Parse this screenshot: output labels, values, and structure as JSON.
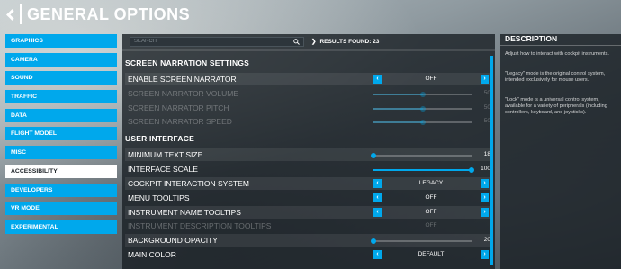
{
  "header": {
    "title": "GENERAL OPTIONS"
  },
  "sidebar": {
    "items": [
      {
        "label": "GRAPHICS",
        "active": false
      },
      {
        "label": "CAMERA",
        "active": false
      },
      {
        "label": "SOUND",
        "active": false
      },
      {
        "label": "TRAFFIC",
        "active": false
      },
      {
        "label": "DATA",
        "active": false
      },
      {
        "label": "FLIGHT MODEL",
        "active": false
      },
      {
        "label": "MISC",
        "active": false
      },
      {
        "label": "ACCESSIBILITY",
        "active": true
      },
      {
        "label": "DEVELOPERS",
        "active": false
      },
      {
        "label": "VR MODE",
        "active": false
      },
      {
        "label": "EXPERIMENTAL",
        "active": false
      }
    ]
  },
  "search": {
    "placeholder": "SEARCH",
    "value": ""
  },
  "results": {
    "label": "RESULTS FOUND: 23"
  },
  "sections": {
    "narration": {
      "title": "SCREEN NARRATION SETTINGS",
      "enable_narrator": {
        "label": "ENABLE SCREEN NARRATOR",
        "value": "OFF"
      },
      "volume": {
        "label": "SCREEN NARRATOR VOLUME",
        "value": "50",
        "fraction": 0.5
      },
      "pitch": {
        "label": "SCREEN NARRATOR PITCH",
        "value": "50",
        "fraction": 0.5
      },
      "speed": {
        "label": "SCREEN NARRATOR SPEED",
        "value": "50",
        "fraction": 0.5
      }
    },
    "ui": {
      "title": "USER INTERFACE",
      "min_text_size": {
        "label": "MINIMUM TEXT SIZE",
        "value": "18",
        "fraction": 0.0
      },
      "interface_scale": {
        "label": "INTERFACE SCALE",
        "value": "100",
        "fraction": 1.0
      },
      "cockpit_system": {
        "label": "COCKPIT INTERACTION SYSTEM",
        "value": "LEGACY"
      },
      "menu_tooltips": {
        "label": "MENU TOOLTIPS",
        "value": "OFF"
      },
      "instrument_name_tooltips": {
        "label": "INSTRUMENT NAME TOOLTIPS",
        "value": "OFF"
      },
      "instrument_desc_tooltips": {
        "label": "INSTRUMENT DESCRIPTION TOOLTIPS",
        "value": "OFF"
      },
      "background_opacity": {
        "label": "BACKGROUND OPACITY",
        "value": "20",
        "fraction": 0.0
      },
      "main_color": {
        "label": "MAIN COLOR",
        "value": "DEFAULT"
      }
    }
  },
  "description": {
    "title": "DESCRIPTION",
    "p1": "Adjust how to interact with cockpit instruments.",
    "p2": "\"Legacy\" mode is the original control system, intended exclusively for mouse users.",
    "p3": "\"Lock\" mode is a universal control system, available for a variety of peripherals (including controllers, keyboard, and joysticks)."
  },
  "colors": {
    "accent": "#00a8ec",
    "panel": "#191f24",
    "active_item": "#ffffff"
  },
  "icons": {
    "back": "chevron-left-icon",
    "search": "search-icon",
    "results": "chevron-right-icon"
  }
}
